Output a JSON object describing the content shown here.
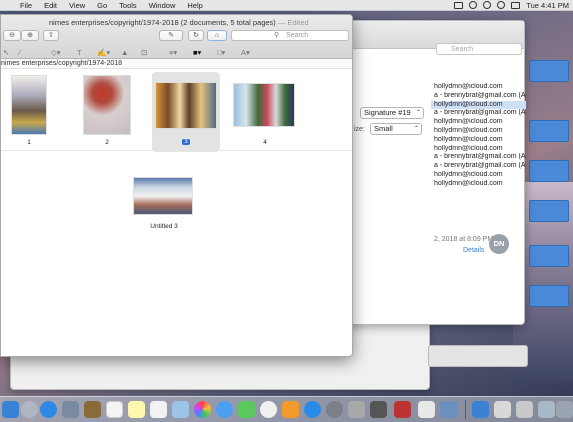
{
  "menubar": {
    "apple_glyph": "",
    "items": [
      "File",
      "Edit",
      "View",
      "Go",
      "Tools",
      "Window",
      "Help"
    ],
    "clock": "Tue 4:41 PM"
  },
  "mail_window": {
    "search_placeholder": "Search",
    "signature_value": "Signature #19",
    "size_label": "ize:",
    "size_value": "Small",
    "recipients": [
      "hollydmn@icloud.com",
      "a - brennybrat@gmail.com (All M",
      "hollydmn@icloud.com",
      "a - brennybrat@gmail.com (All M",
      "hollydmn@icloud.com",
      "hollydmn@icloud.com",
      "hollydmn@icloud.com",
      "hollydmn@icloud.com",
      "a - brennybrat@gmail.com (All M",
      "a - brennybrat@gmail.com (All M",
      "hollydmn@icloud.com",
      "hollydmn@icloud.com"
    ],
    "date_line": "2, 2018 at 8:09 PM",
    "details_link": "Details",
    "avatar_initials": "DN"
  },
  "preview_window": {
    "title": "nimes enterprises/copyright/1974-2018 (2 documents, 5 total pages)",
    "title_suffix": " — Edited",
    "search_placeholder": "Search",
    "path": "nimes enterprises/copyright/1974-2018",
    "pages": [
      {
        "label": "1",
        "selected": false
      },
      {
        "label": "2",
        "selected": false
      },
      {
        "label": "3",
        "selected": true
      },
      {
        "label": "4",
        "selected": false
      }
    ],
    "second_doc": {
      "label": "Untitled 3"
    }
  },
  "colors": {
    "accent": "#2b6ecf",
    "selection_bg": "#cfe0f6",
    "link": "#3b7fd8"
  }
}
